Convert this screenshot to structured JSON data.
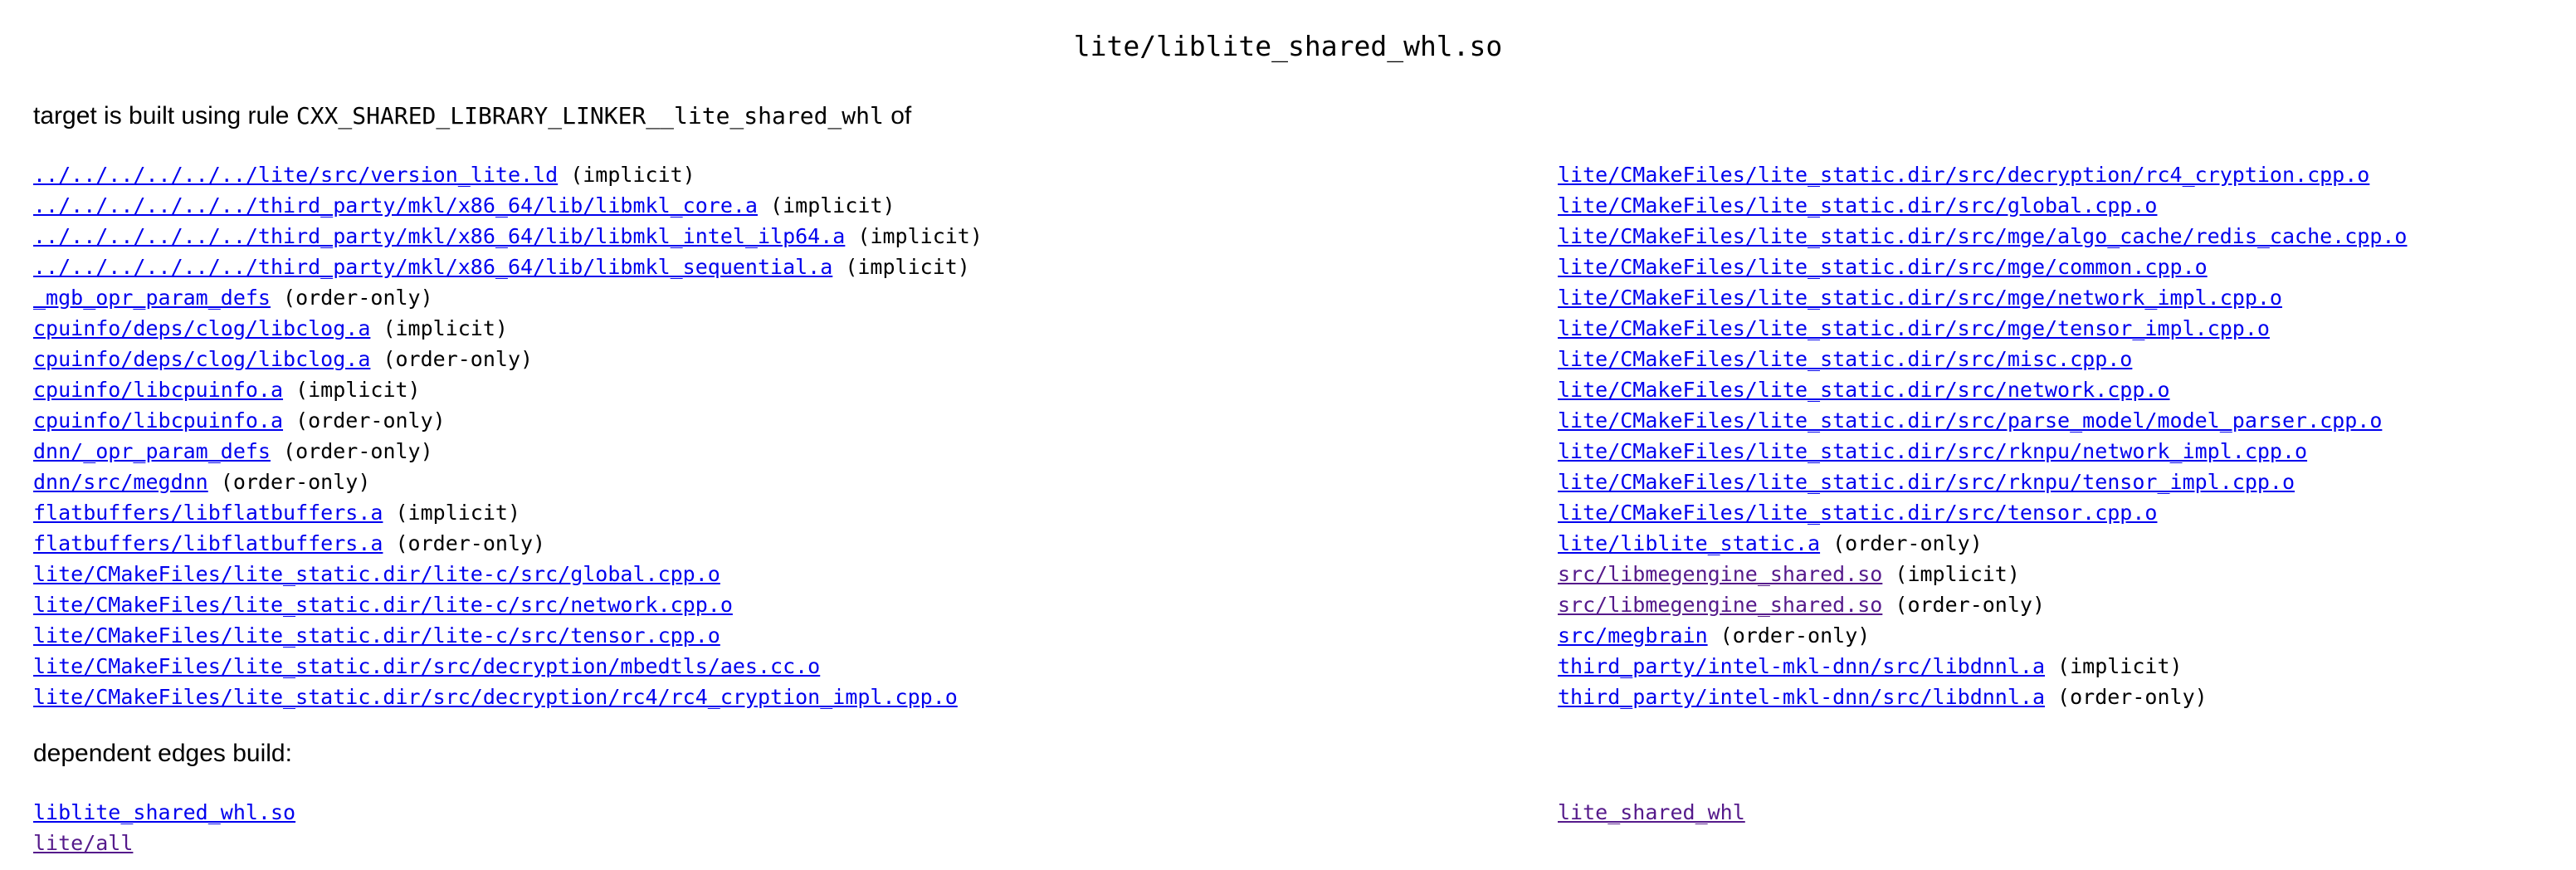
{
  "title": "lite/liblite_shared_whl.so",
  "rule_heading": {
    "prefix": "target is built using rule ",
    "rule_name": "CXX_SHARED_LIBRARY_LINKER__lite_shared_whl",
    "suffix": " of"
  },
  "deps_heading": "dependent edges build:",
  "inputs": {
    "left": [
      {
        "path": "../../../../../../lite/src/version_lite.ld",
        "kind": " (implicit)",
        "visited": false
      },
      {
        "path": "../../../../../../third_party/mkl/x86_64/lib/libmkl_core.a",
        "kind": " (implicit)",
        "visited": false
      },
      {
        "path": "../../../../../../third_party/mkl/x86_64/lib/libmkl_intel_ilp64.a",
        "kind": " (implicit)",
        "visited": false
      },
      {
        "path": "../../../../../../third_party/mkl/x86_64/lib/libmkl_sequential.a",
        "kind": " (implicit)",
        "visited": false
      },
      {
        "path": "_mgb_opr_param_defs",
        "kind": " (order-only)",
        "visited": false
      },
      {
        "path": "cpuinfo/deps/clog/libclog.a",
        "kind": " (implicit)",
        "visited": false
      },
      {
        "path": "cpuinfo/deps/clog/libclog.a",
        "kind": " (order-only)",
        "visited": false
      },
      {
        "path": "cpuinfo/libcpuinfo.a",
        "kind": " (implicit)",
        "visited": false
      },
      {
        "path": "cpuinfo/libcpuinfo.a",
        "kind": " (order-only)",
        "visited": false
      },
      {
        "path": "dnn/_opr_param_defs",
        "kind": " (order-only)",
        "visited": false
      },
      {
        "path": "dnn/src/megdnn",
        "kind": " (order-only)",
        "visited": false
      },
      {
        "path": "flatbuffers/libflatbuffers.a",
        "kind": " (implicit)",
        "visited": false
      },
      {
        "path": "flatbuffers/libflatbuffers.a",
        "kind": " (order-only)",
        "visited": false
      },
      {
        "path": "lite/CMakeFiles/lite_static.dir/lite-c/src/global.cpp.o",
        "kind": "",
        "visited": false
      },
      {
        "path": "lite/CMakeFiles/lite_static.dir/lite-c/src/network.cpp.o",
        "kind": "",
        "visited": false
      },
      {
        "path": "lite/CMakeFiles/lite_static.dir/lite-c/src/tensor.cpp.o",
        "kind": "",
        "visited": false
      },
      {
        "path": "lite/CMakeFiles/lite_static.dir/src/decryption/mbedtls/aes.cc.o",
        "kind": "",
        "visited": false
      },
      {
        "path": "lite/CMakeFiles/lite_static.dir/src/decryption/rc4/rc4_cryption_impl.cpp.o",
        "kind": "",
        "visited": false
      }
    ],
    "right": [
      {
        "path": "lite/CMakeFiles/lite_static.dir/src/decryption/rc4_cryption.cpp.o",
        "kind": "",
        "visited": false
      },
      {
        "path": "lite/CMakeFiles/lite_static.dir/src/global.cpp.o",
        "kind": "",
        "visited": false
      },
      {
        "path": "lite/CMakeFiles/lite_static.dir/src/mge/algo_cache/redis_cache.cpp.o",
        "kind": "",
        "visited": false
      },
      {
        "path": "lite/CMakeFiles/lite_static.dir/src/mge/common.cpp.o",
        "kind": "",
        "visited": false
      },
      {
        "path": "lite/CMakeFiles/lite_static.dir/src/mge/network_impl.cpp.o",
        "kind": "",
        "visited": false
      },
      {
        "path": "lite/CMakeFiles/lite_static.dir/src/mge/tensor_impl.cpp.o",
        "kind": "",
        "visited": false
      },
      {
        "path": "lite/CMakeFiles/lite_static.dir/src/misc.cpp.o",
        "kind": "",
        "visited": false
      },
      {
        "path": "lite/CMakeFiles/lite_static.dir/src/network.cpp.o",
        "kind": "",
        "visited": false
      },
      {
        "path": "lite/CMakeFiles/lite_static.dir/src/parse_model/model_parser.cpp.o",
        "kind": "",
        "visited": false
      },
      {
        "path": "lite/CMakeFiles/lite_static.dir/src/rknpu/network_impl.cpp.o",
        "kind": "",
        "visited": false
      },
      {
        "path": "lite/CMakeFiles/lite_static.dir/src/rknpu/tensor_impl.cpp.o",
        "kind": "",
        "visited": false
      },
      {
        "path": "lite/CMakeFiles/lite_static.dir/src/tensor.cpp.o",
        "kind": "",
        "visited": false
      },
      {
        "path": "lite/liblite_static.a",
        "kind": " (order-only)",
        "visited": false
      },
      {
        "path": "src/libmegengine_shared.so",
        "kind": " (implicit)",
        "visited": true
      },
      {
        "path": "src/libmegengine_shared.so",
        "kind": " (order-only)",
        "visited": true
      },
      {
        "path": "src/megbrain",
        "kind": " (order-only)",
        "visited": false
      },
      {
        "path": "third_party/intel-mkl-dnn/src/libdnnl.a",
        "kind": " (implicit)",
        "visited": false
      },
      {
        "path": "third_party/intel-mkl-dnn/src/libdnnl.a",
        "kind": " (order-only)",
        "visited": false
      }
    ]
  },
  "edges": {
    "left": [
      {
        "path": "liblite_shared_whl.so",
        "kind": "",
        "visited": false
      },
      {
        "path": "lite/all",
        "kind": "",
        "visited": true
      }
    ],
    "right": [
      {
        "path": "lite_shared_whl",
        "kind": "",
        "visited": true
      }
    ]
  },
  "colors": {
    "link": "#0000ee",
    "visited_link": "#551a8b",
    "text": "#000000",
    "background": "#ffffff"
  }
}
